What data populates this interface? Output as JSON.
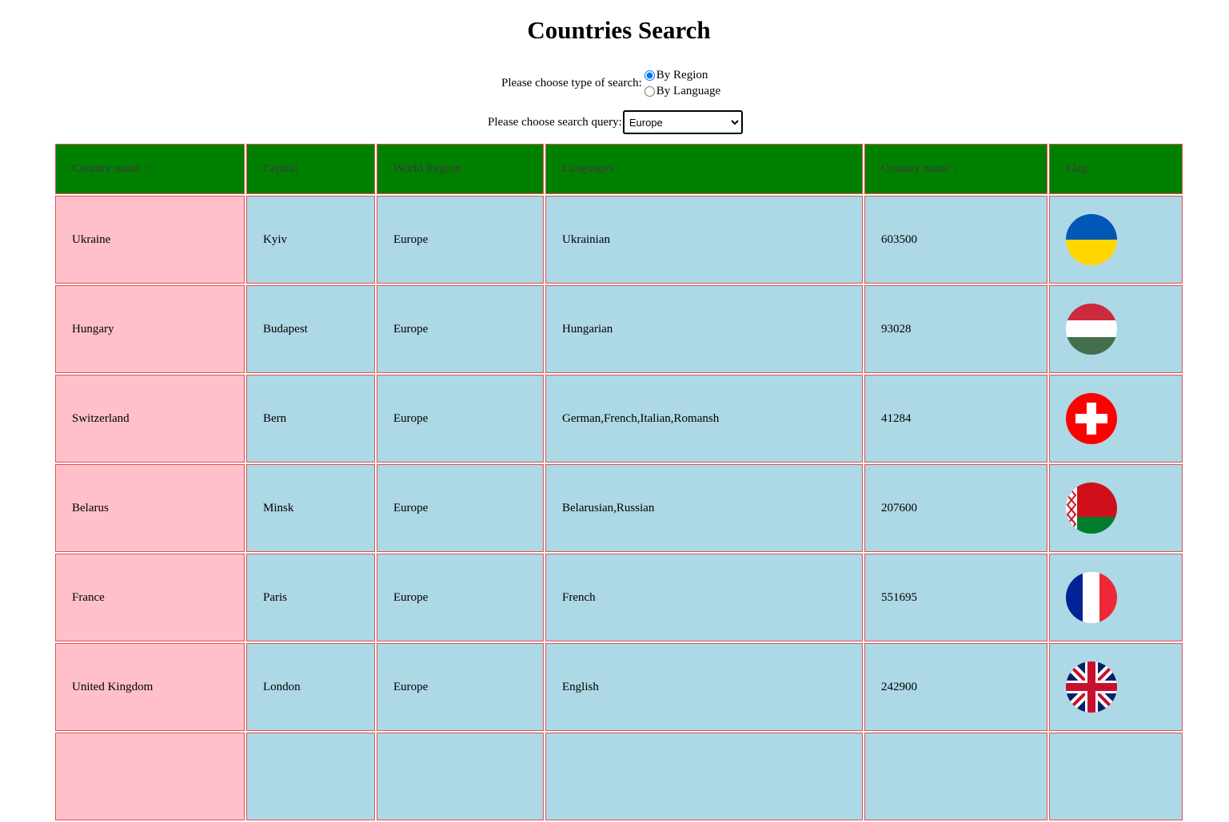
{
  "page": {
    "title": "Countries Search"
  },
  "search_type": {
    "label": "Please choose type of search:",
    "options": [
      {
        "label": "By Region",
        "checked": true
      },
      {
        "label": "By Language",
        "checked": false
      }
    ]
  },
  "search_query": {
    "label": "Please choose search query:",
    "selected": "Europe"
  },
  "table": {
    "headers": [
      "Country name ↑",
      "Capital",
      "World Region",
      "Languages",
      "Country name ↓",
      "Flag"
    ],
    "rows": [
      {
        "name": "Ukraine",
        "capital": "Kyiv",
        "region": "Europe",
        "languages": "Ukrainian",
        "area": "603500",
        "flag": "ukraine-flag"
      },
      {
        "name": "Hungary",
        "capital": "Budapest",
        "region": "Europe",
        "languages": "Hungarian",
        "area": "93028",
        "flag": "hungary-flag"
      },
      {
        "name": "Switzerland",
        "capital": "Bern",
        "region": "Europe",
        "languages": "German,French,Italian,Romansh",
        "area": "41284",
        "flag": "switzerland-flag"
      },
      {
        "name": "Belarus",
        "capital": "Minsk",
        "region": "Europe",
        "languages": "Belarusian,Russian",
        "area": "207600",
        "flag": "belarus-flag"
      },
      {
        "name": "France",
        "capital": "Paris",
        "region": "Europe",
        "languages": "French",
        "area": "551695",
        "flag": "france-flag"
      },
      {
        "name": "United Kingdom",
        "capital": "London",
        "region": "Europe",
        "languages": "English",
        "area": "242900",
        "flag": "united-kingdom-flag"
      }
    ]
  },
  "colors": {
    "header_bg": "#008000",
    "name_cell_bg": "#ffc0cb",
    "cell_bg": "#add8e6",
    "border": "#e05050"
  }
}
